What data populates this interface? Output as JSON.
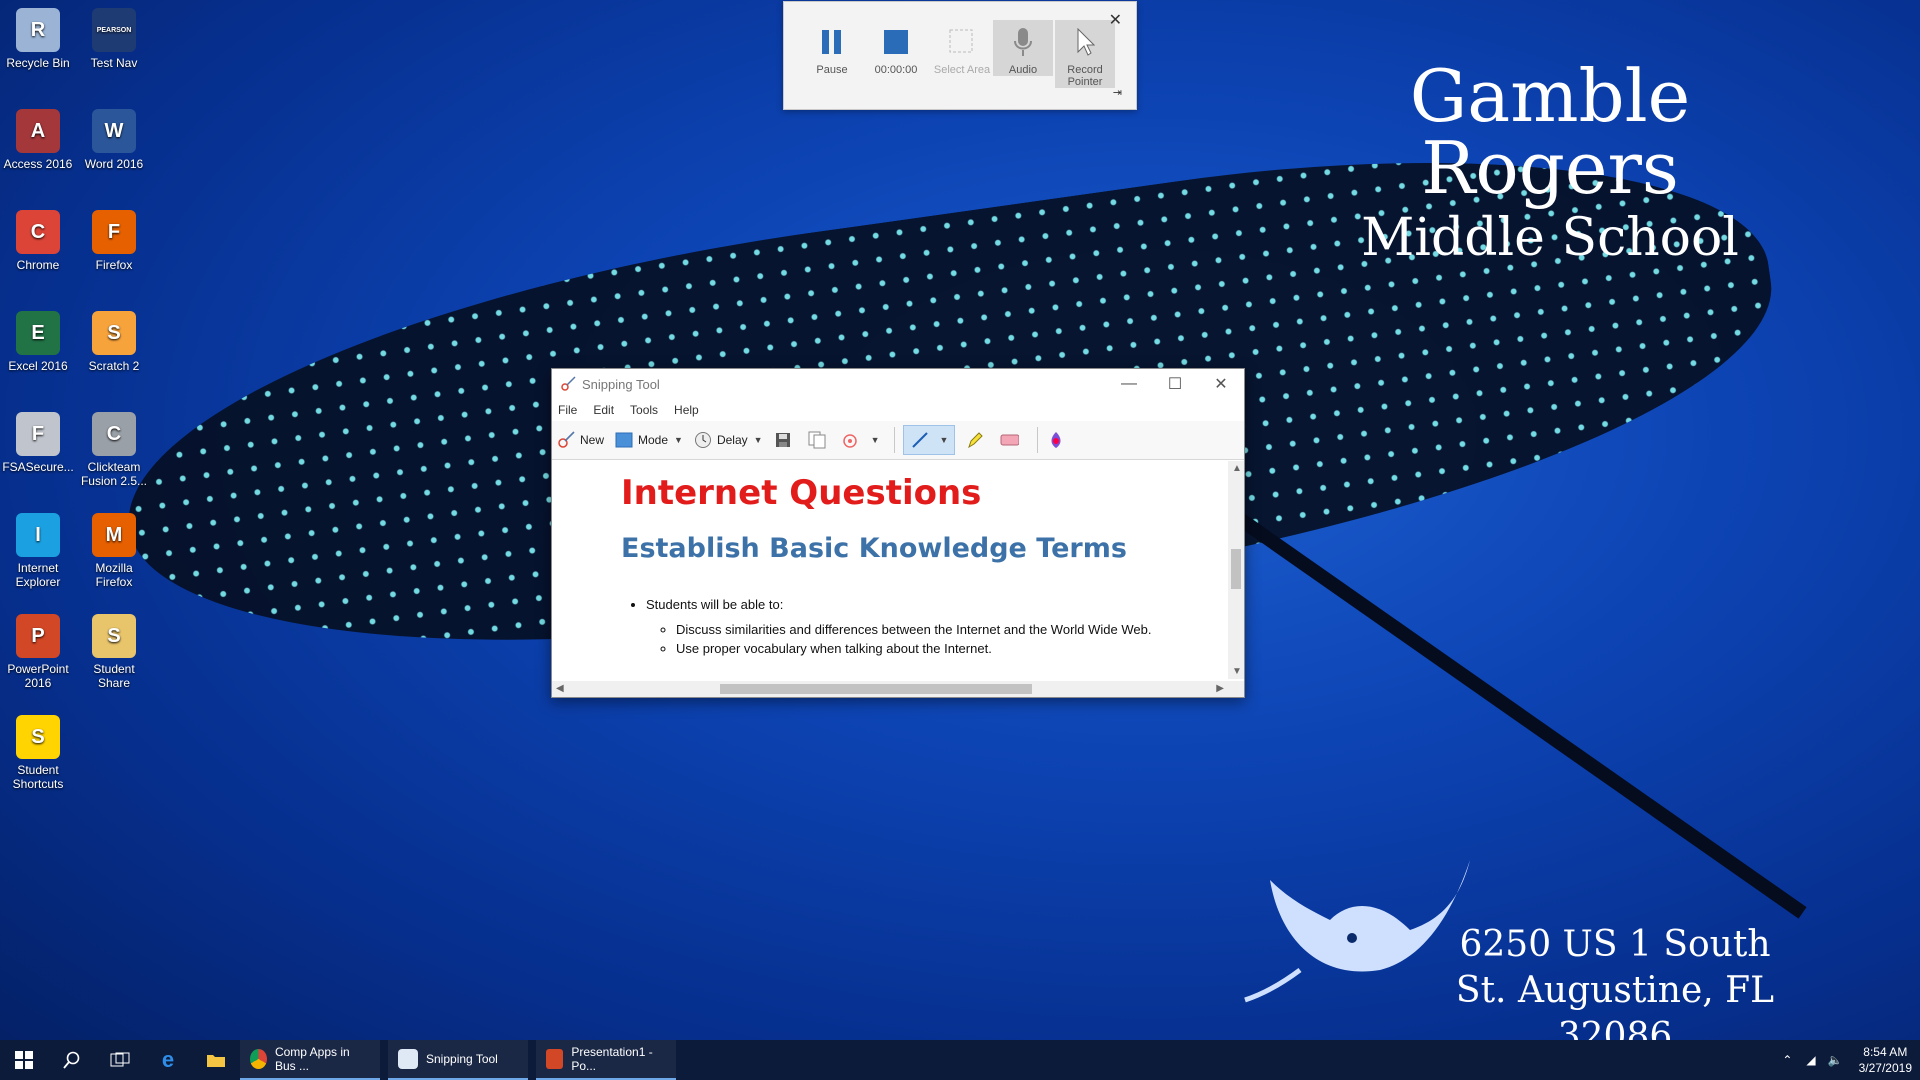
{
  "wallpaper": {
    "school_name_line1": "Gamble Rogers",
    "school_name_line2": "Middle School",
    "address_line1": "6250 US 1 South",
    "address_line2": "St. Augustine, FL 32086"
  },
  "desktop_icons": [
    {
      "label": "Recycle Bin",
      "icon": "recycle-bin-icon",
      "color": "#9bb4d6"
    },
    {
      "label": "Test Nav",
      "icon": "testnav-icon",
      "color": "#1f3b73",
      "brand": "PEARSON"
    },
    {
      "label": "Access 2016",
      "icon": "access-icon",
      "color": "#a4373a"
    },
    {
      "label": "Word 2016",
      "icon": "word-icon",
      "color": "#2b579a"
    },
    {
      "label": "Chrome",
      "icon": "chrome-icon",
      "color": "#db4437"
    },
    {
      "label": "Firefox",
      "icon": "firefox-icon",
      "color": "#e66000"
    },
    {
      "label": "Excel 2016",
      "icon": "excel-icon",
      "color": "#217346"
    },
    {
      "label": "Scratch 2",
      "icon": "scratch-icon",
      "color": "#f7a33c"
    },
    {
      "label": "FSASecure...",
      "icon": "fsa-secure-icon",
      "color": "#c0c4cc"
    },
    {
      "label": "Clickteam Fusion 2.5...",
      "icon": "clickteam-icon",
      "color": "#9aa0a8"
    },
    {
      "label": "Internet Explorer",
      "icon": "internet-explorer-icon",
      "color": "#1ba1e2"
    },
    {
      "label": "Mozilla Firefox",
      "icon": "mozilla-firefox-icon",
      "color": "#e66000"
    },
    {
      "label": "PowerPoint 2016",
      "icon": "powerpoint-icon",
      "color": "#d24726"
    },
    {
      "label": "Student Share",
      "icon": "student-share-icon",
      "color": "#e8c46a"
    },
    {
      "label": "Student Shortcuts",
      "icon": "star-icon",
      "color": "#ffd400"
    }
  ],
  "recorder": {
    "pause_label": "Pause",
    "timer": "00:00:00",
    "select_area_label": "Select Area",
    "audio_label": "Audio",
    "record_pointer_label": "Record Pointer"
  },
  "snipping_tool": {
    "title": "Snipping Tool",
    "menu": [
      "File",
      "Edit",
      "Tools",
      "Help"
    ],
    "toolbar": {
      "new_label": "New",
      "mode_label": "Mode",
      "delay_label": "Delay"
    },
    "document": {
      "heading": "Internet Questions",
      "subheading": "Establish Basic Knowledge Terms",
      "bullet": "Students will be able to:",
      "sub_bullets": [
        "Discuss similarities and differences between the Internet and the World Wide Web.",
        "Use proper vocabulary when talking about the Internet."
      ]
    }
  },
  "taskbar": {
    "apps": [
      {
        "label": "Comp Apps in Bus ...",
        "icon": "chrome-icon"
      },
      {
        "label": "Snipping Tool",
        "icon": "snipping-tool-icon"
      },
      {
        "label": "Presentation1 - Po...",
        "icon": "powerpoint-icon"
      }
    ],
    "time": "8:54 AM",
    "date": "3/27/2019"
  }
}
